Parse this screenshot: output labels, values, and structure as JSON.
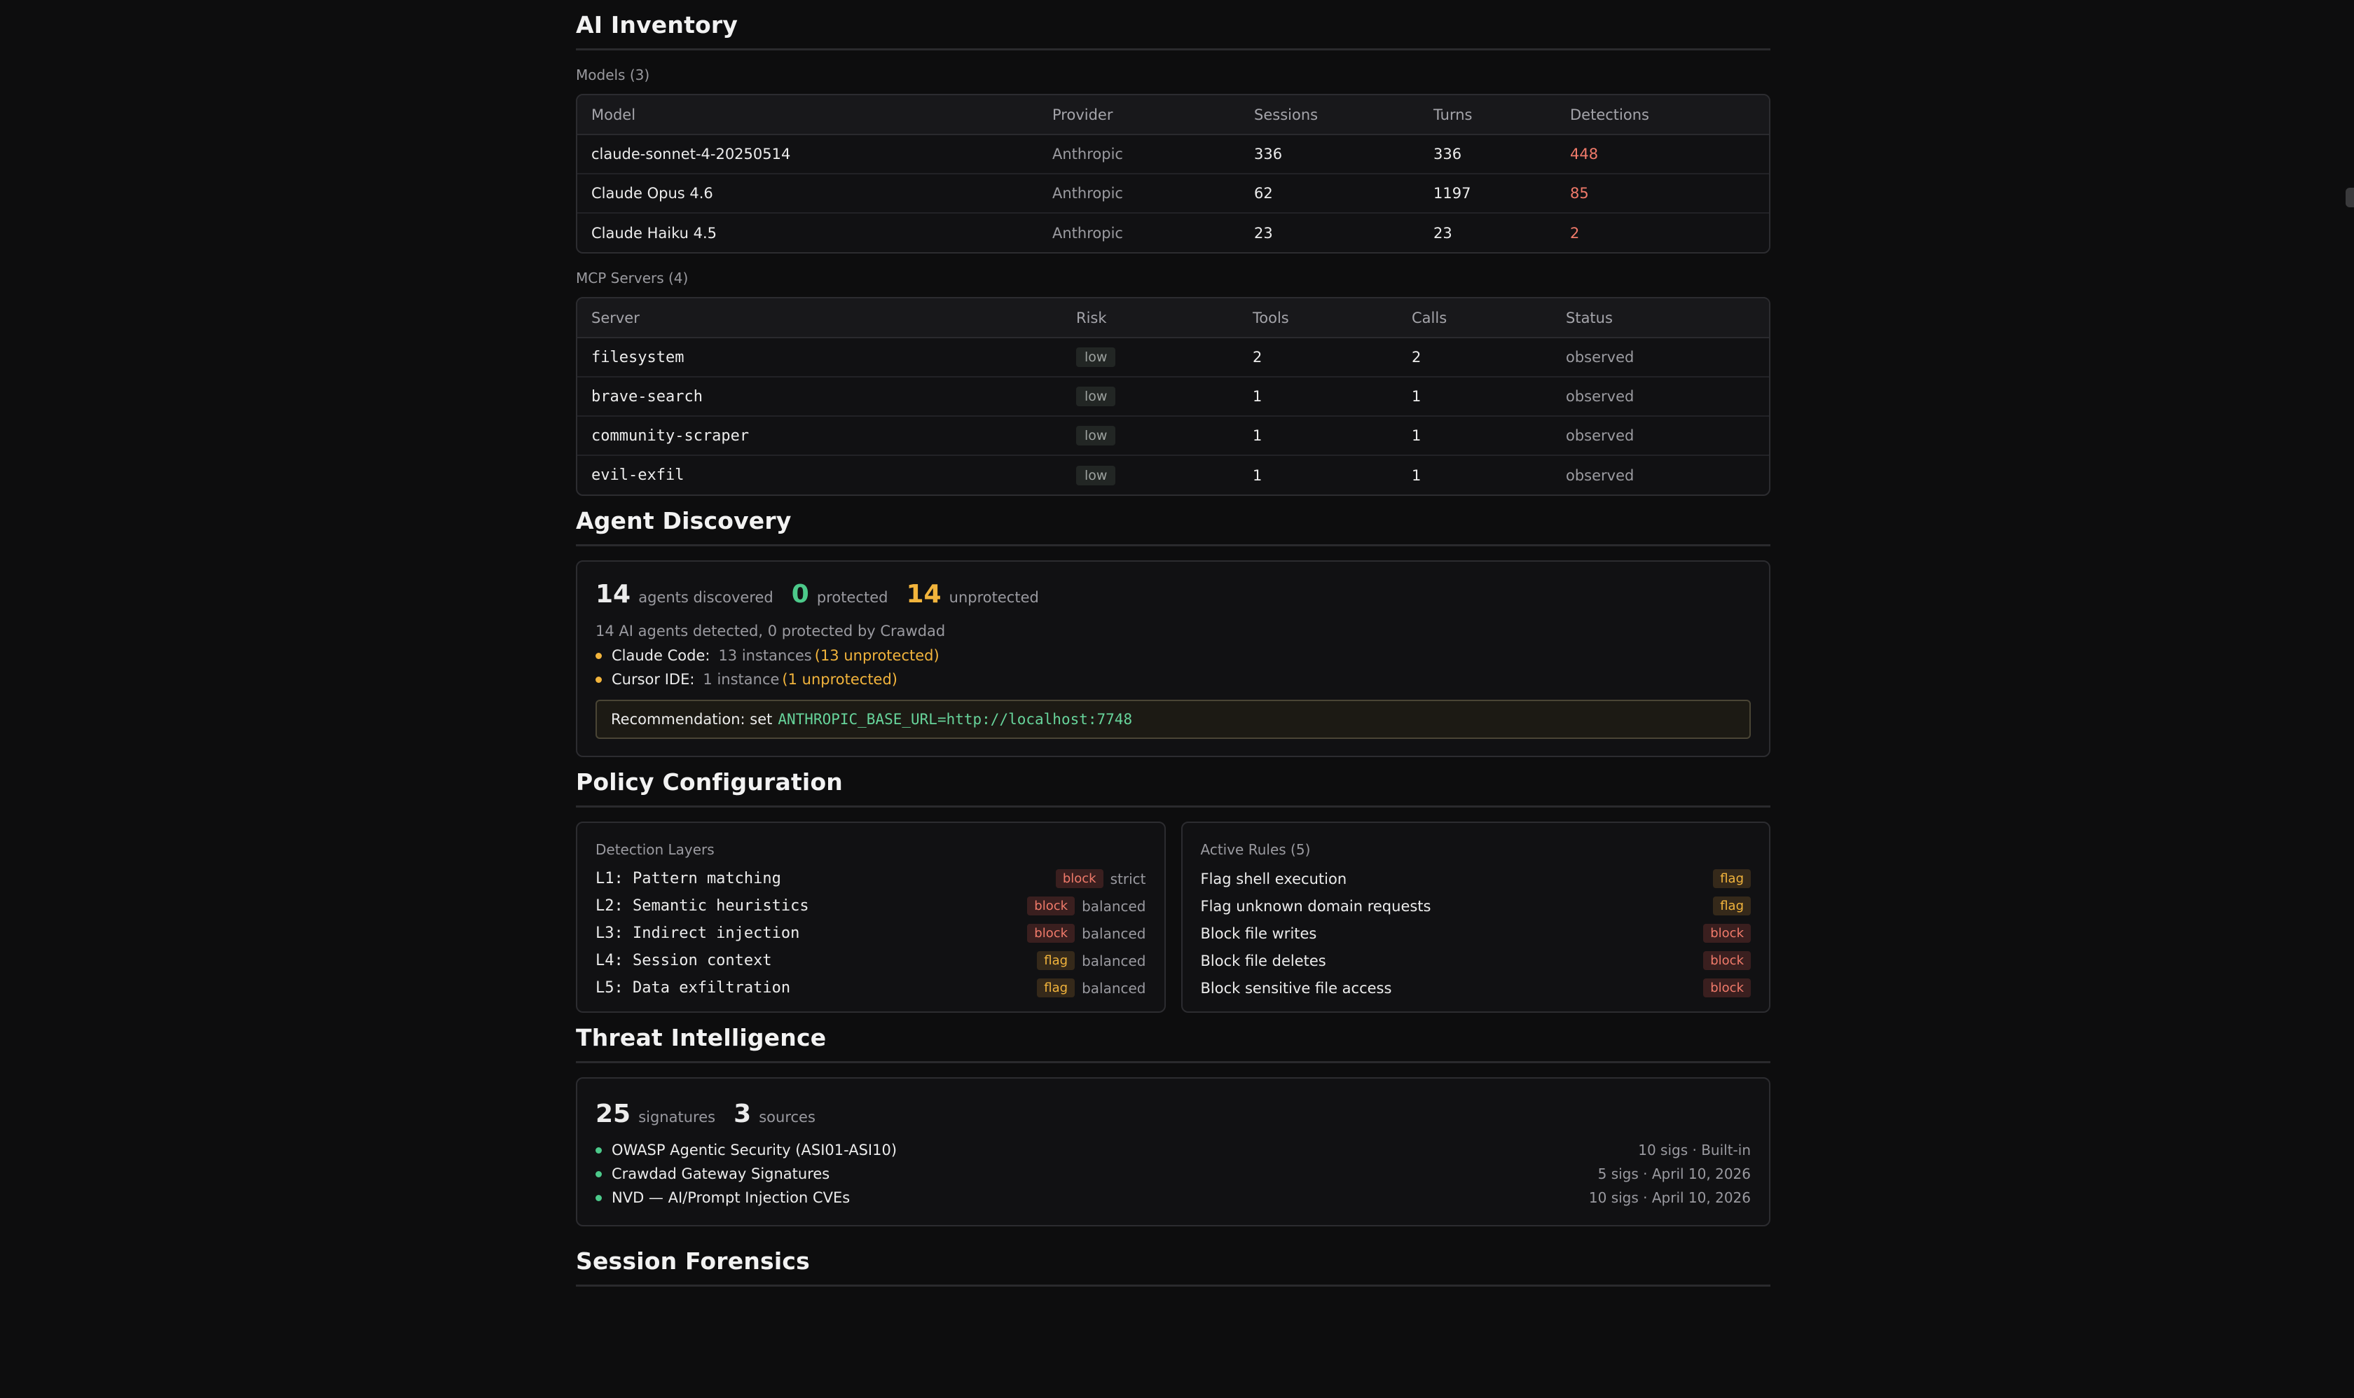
{
  "inventory": {
    "title": "AI Inventory",
    "models_label": "Models (3)",
    "model_headers": [
      "Model",
      "Provider",
      "Sessions",
      "Turns",
      "Detections"
    ],
    "models": [
      {
        "model": "claude-sonnet-4-20250514",
        "provider": "Anthropic",
        "sessions": "336",
        "turns": "336",
        "detections": "448"
      },
      {
        "model": "Claude Opus 4.6",
        "provider": "Anthropic",
        "sessions": "62",
        "turns": "1197",
        "detections": "85"
      },
      {
        "model": "Claude Haiku 4.5",
        "provider": "Anthropic",
        "sessions": "23",
        "turns": "23",
        "detections": "2"
      }
    ],
    "mcp_label": "MCP Servers (4)",
    "mcp_headers": [
      "Server",
      "Risk",
      "Tools",
      "Calls",
      "Status"
    ],
    "servers": [
      {
        "server": "filesystem",
        "risk": "low",
        "tools": "2",
        "calls": "2",
        "status": "observed"
      },
      {
        "server": "brave-search",
        "risk": "low",
        "tools": "1",
        "calls": "1",
        "status": "observed"
      },
      {
        "server": "community-scraper",
        "risk": "low",
        "tools": "1",
        "calls": "1",
        "status": "observed"
      },
      {
        "server": "evil-exfil",
        "risk": "low",
        "tools": "1",
        "calls": "1",
        "status": "observed"
      }
    ]
  },
  "discovery": {
    "title": "Agent Discovery",
    "discovered_num": "14",
    "discovered_lbl": "agents discovered",
    "protected_num": "0",
    "protected_lbl": "protected",
    "unprotected_num": "14",
    "unprotected_lbl": "unprotected",
    "summary": "14 AI agents detected, 0 protected by Crawdad",
    "agents": [
      {
        "name": "Claude Code:",
        "instances": "13 instances",
        "unprotected": "(13 unprotected)"
      },
      {
        "name": "Cursor IDE:",
        "instances": "1 instance",
        "unprotected": "(1 unprotected)"
      }
    ],
    "recommendation_label": "Recommendation: set",
    "recommendation_code": "ANTHROPIC_BASE_URL=http://localhost:7748"
  },
  "policy": {
    "title": "Policy Configuration",
    "layers_title": "Detection Layers",
    "layers": [
      {
        "name": "L1: Pattern matching",
        "action": "block",
        "mode": "strict"
      },
      {
        "name": "L2: Semantic heuristics",
        "action": "block",
        "mode": "balanced"
      },
      {
        "name": "L3: Indirect injection",
        "action": "block",
        "mode": "balanced"
      },
      {
        "name": "L4: Session context",
        "action": "flag",
        "mode": "balanced"
      },
      {
        "name": "L5: Data exfiltration",
        "action": "flag",
        "mode": "balanced"
      }
    ],
    "rules_title": "Active Rules (5)",
    "rules": [
      {
        "name": "Flag shell execution",
        "action": "flag"
      },
      {
        "name": "Flag unknown domain requests",
        "action": "flag"
      },
      {
        "name": "Block file writes",
        "action": "block"
      },
      {
        "name": "Block file deletes",
        "action": "block"
      },
      {
        "name": "Block sensitive file access",
        "action": "block"
      }
    ]
  },
  "threat": {
    "title": "Threat Intelligence",
    "signatures_num": "25",
    "signatures_lbl": "signatures",
    "sources_num": "3",
    "sources_lbl": "sources",
    "sources": [
      {
        "name": "OWASP Agentic Security (ASI01-ASI10)",
        "meta": "10 sigs · Built-in"
      },
      {
        "name": "Crawdad Gateway Signatures",
        "meta": "5 sigs · April 10, 2026"
      },
      {
        "name": "NVD — AI/Prompt Injection CVEs",
        "meta": "10 sigs · April 10, 2026"
      }
    ]
  },
  "forensics": {
    "title": "Session Forensics"
  },
  "colors": {
    "background": "#0d0d0e",
    "danger": "#f07a6a",
    "warning": "#f2b43c",
    "success": "#4cc98a",
    "code": "#67d49b"
  }
}
